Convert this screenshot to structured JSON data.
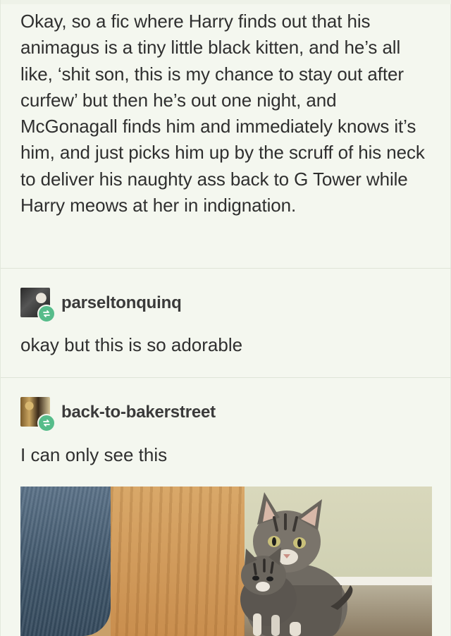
{
  "original_post": {
    "text": "Okay, so a fic where Harry finds out that his animagus is a tiny little black kitten, and he’s all like, ‘shit son, this is my chance to stay out after curfew’ but then he’s out one night, and McGonagall finds him and immediately knows it’s him, and just picks him up by the scruff of his neck to deliver his naughty ass back to G Tower while Harry meows at her in indignation."
  },
  "reblogs": [
    {
      "username": "parseltonquinq",
      "text": "okay but this is so adorable",
      "avatar_icon": "user-avatar",
      "badge_icon": "reblog-icon"
    },
    {
      "username": "back-to-bakerstreet",
      "text": "I can only see this",
      "avatar_icon": "user-avatar",
      "badge_icon": "reblog-icon"
    }
  ],
  "colors": {
    "background": "#f4f7ef",
    "text": "#2f2f2f",
    "reblog_badge": "#56bc8a"
  }
}
